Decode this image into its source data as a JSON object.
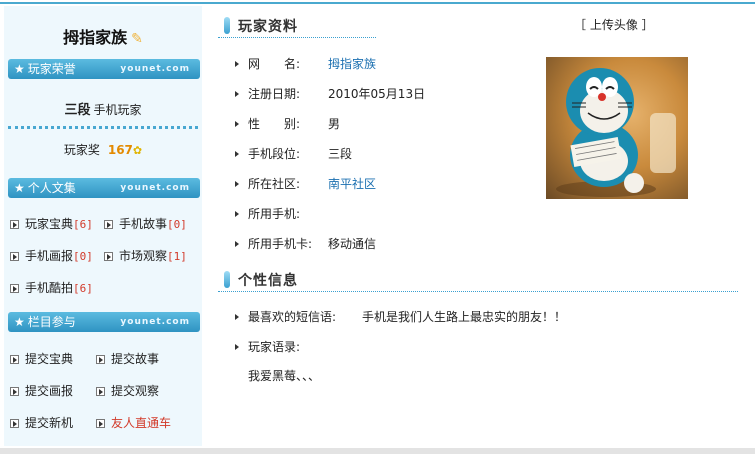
{
  "sidebar": {
    "username": "拇指家族",
    "honor_title": "玩家荣誉",
    "watermark": "younet.com",
    "rank_level": "三段",
    "rank_name": "手机玩家",
    "award_label": "玩家奖",
    "award_value": "167",
    "articles_title": "个人文集",
    "articles": [
      {
        "label": "玩家宝典",
        "count": "[6]"
      },
      {
        "label": "手机故事",
        "count": "[0]"
      },
      {
        "label": "手机画报",
        "count": "[0]"
      },
      {
        "label": "市场观察",
        "count": "[1]"
      },
      {
        "label": "手机酷拍",
        "count": "[6]"
      }
    ],
    "column_title": "栏目参与",
    "column_links": [
      {
        "label": "提交宝典"
      },
      {
        "label": "提交故事"
      },
      {
        "label": "提交画报"
      },
      {
        "label": "提交观察"
      },
      {
        "label": "提交新机"
      },
      {
        "label": "友人直通车"
      }
    ]
  },
  "profile": {
    "title": "玩家资料",
    "upload_label": "［ 上传头像 ］",
    "rows": [
      {
        "label": "网　　名:",
        "value": "拇指家族"
      },
      {
        "label": "注册日期:",
        "value": "2010年05月13日"
      },
      {
        "label": "性　　别:",
        "value": "男"
      },
      {
        "label": "手机段位:",
        "value": "三段"
      },
      {
        "label": "所在社区:",
        "value": "南平社区"
      },
      {
        "label": "所用手机:",
        "value": ""
      },
      {
        "label": "所用手机卡:",
        "value": "移动通信"
      }
    ]
  },
  "personal": {
    "title": "个性信息",
    "sms_label": "最喜欢的短信语:",
    "sms_value": "手机是我们人生路上最忠实的朋友！！",
    "quote_label": "玩家语录:",
    "quote_value": "我爱黑莓、、、"
  },
  "colors": {
    "accent": "#3aa0d0",
    "link": "#1a6fb0",
    "count": "#d23a2a",
    "sidebar_bg": "#eef8fd"
  }
}
